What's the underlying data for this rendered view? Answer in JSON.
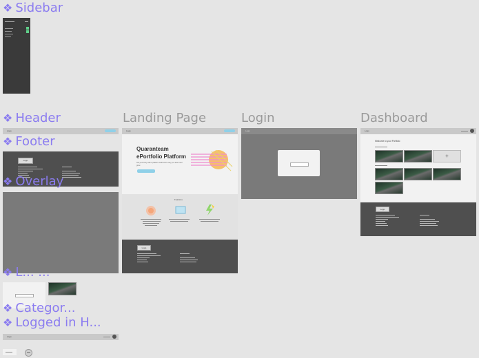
{
  "components": {
    "sidebar": "Sidebar",
    "header": "Header",
    "footer": "Footer",
    "overlay": "Overlay",
    "truncated": "L...   ...",
    "category": "Categor...",
    "logged_in_header": "Logged in H..."
  },
  "frames": {
    "landing": "Landing Page",
    "login": "Login",
    "dashboard": "Dashboard"
  },
  "landing": {
    "hero_title": "Quaranteam ePortfolio Platform",
    "hero_sub": "Tell your story with a platform built for the way you learn and grow",
    "features_title": "Features"
  },
  "dashboard": {
    "welcome": "Welcome to your Portfolio"
  },
  "footer": {
    "logo": "Logo"
  },
  "header": {
    "logo": "Logo"
  },
  "colors": {
    "component_label": "#8b7cf0",
    "frame_label": "#9a9a9a",
    "canvas": "#e5e5e5",
    "accent": "#8fd0e8"
  }
}
